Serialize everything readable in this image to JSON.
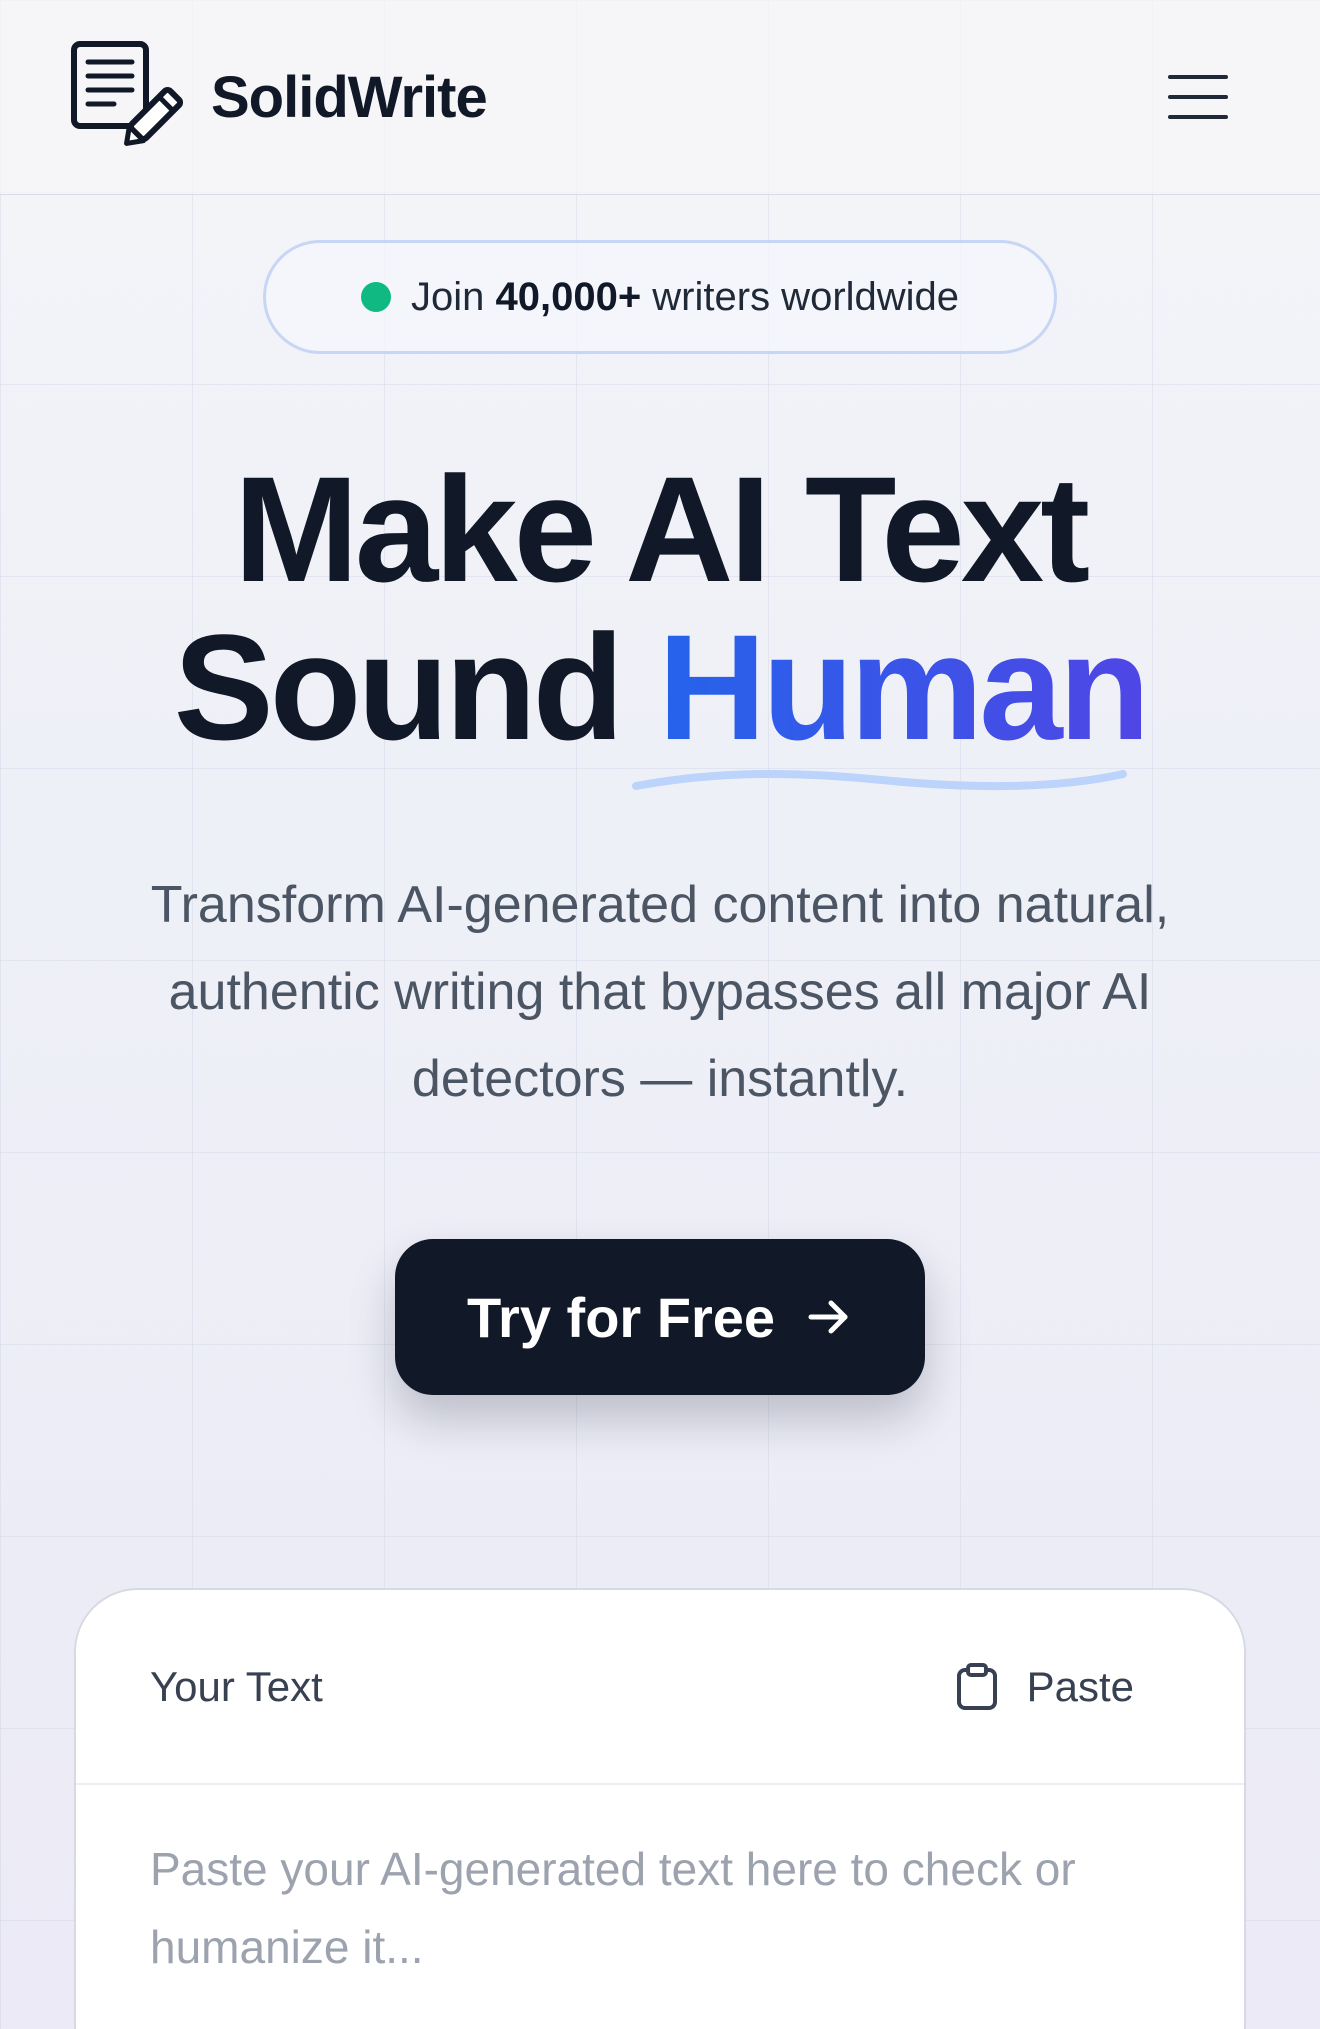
{
  "header": {
    "brand_name": "SolidWrite"
  },
  "badge": {
    "prefix": "Join",
    "highlight": "40,000+",
    "suffix": "writers worldwide"
  },
  "hero": {
    "line1": "Make AI Text",
    "line2_plain": "Sound",
    "line2_highlight": "Human",
    "subtitle": "Transform AI-generated content into natural, authentic writing that bypasses all major AI detectors — instantly."
  },
  "cta": {
    "label": "Try for Free"
  },
  "editor": {
    "title": "Your Text",
    "paste_label": "Paste",
    "placeholder": "Paste your AI-generated text here to check or humanize it..."
  },
  "colors": {
    "accent_start": "#2563eb",
    "accent_end": "#4f46e5",
    "badge_dot": "#10b981",
    "dark": "#111827"
  },
  "icons": {
    "logo": "document-pencil-icon",
    "menu": "hamburger-menu-icon",
    "cta": "arrow-right-icon",
    "paste": "clipboard-icon"
  }
}
